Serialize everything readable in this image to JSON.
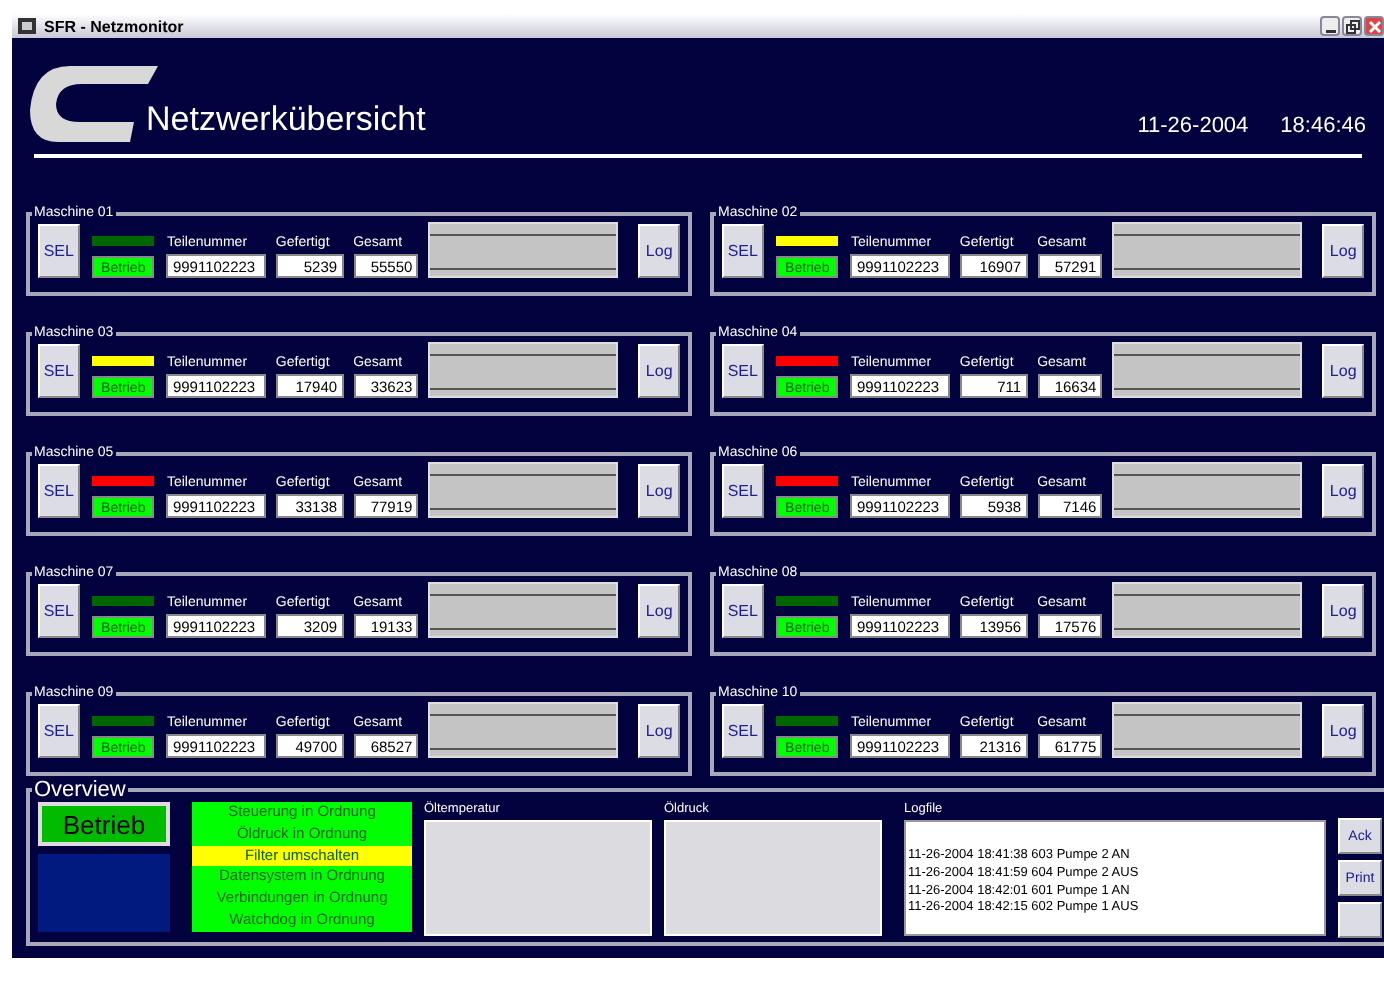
{
  "window": {
    "title": "SFR - Netzmonitor"
  },
  "header": {
    "title": "Netzwerkübersicht",
    "date": "11-26-2004",
    "time": "18:46:46"
  },
  "machines": [
    {
      "name": "Maschine 01",
      "sel": "SEL",
      "log": "Log",
      "color": "#006600",
      "status": "Betrieb",
      "part_label": "Teilenummer",
      "made_label": "Gefertigt",
      "total_label": "Gesamt",
      "part": "9991102223",
      "made": "5239",
      "total": "55550"
    },
    {
      "name": "Maschine 02",
      "sel": "SEL",
      "log": "Log",
      "color": "#ffff00",
      "status": "Betrieb",
      "part_label": "Teilenummer",
      "made_label": "Gefertigt",
      "total_label": "Gesamt",
      "part": "9991102223",
      "made": "16907",
      "total": "57291"
    },
    {
      "name": "Maschine 03",
      "sel": "SEL",
      "log": "Log",
      "color": "#ffff00",
      "status": "Betrieb",
      "part_label": "Teilenummer",
      "made_label": "Gefertigt",
      "total_label": "Gesamt",
      "part": "9991102223",
      "made": "17940",
      "total": "33623"
    },
    {
      "name": "Maschine 04",
      "sel": "SEL",
      "log": "Log",
      "color": "#ff0000",
      "status": "Betrieb",
      "part_label": "Teilenummer",
      "made_label": "Gefertigt",
      "total_label": "Gesamt",
      "part": "9991102223",
      "made": "711",
      "total": "16634"
    },
    {
      "name": "Maschine 05",
      "sel": "SEL",
      "log": "Log",
      "color": "#ff0000",
      "status": "Betrieb",
      "part_label": "Teilenummer",
      "made_label": "Gefertigt",
      "total_label": "Gesamt",
      "part": "9991102223",
      "made": "33138",
      "total": "77919"
    },
    {
      "name": "Maschine 06",
      "sel": "SEL",
      "log": "Log",
      "color": "#ff0000",
      "status": "Betrieb",
      "part_label": "Teilenummer",
      "made_label": "Gefertigt",
      "total_label": "Gesamt",
      "part": "9991102223",
      "made": "5938",
      "total": "7146"
    },
    {
      "name": "Maschine 07",
      "sel": "SEL",
      "log": "Log",
      "color": "#006600",
      "status": "Betrieb",
      "part_label": "Teilenummer",
      "made_label": "Gefertigt",
      "total_label": "Gesamt",
      "part": "9991102223",
      "made": "3209",
      "total": "19133"
    },
    {
      "name": "Maschine 08",
      "sel": "SEL",
      "log": "Log",
      "color": "#006600",
      "status": "Betrieb",
      "part_label": "Teilenummer",
      "made_label": "Gefertigt",
      "total_label": "Gesamt",
      "part": "9991102223",
      "made": "13956",
      "total": "17576"
    },
    {
      "name": "Maschine 09",
      "sel": "SEL",
      "log": "Log",
      "color": "#006600",
      "status": "Betrieb",
      "part_label": "Teilenummer",
      "made_label": "Gefertigt",
      "total_label": "Gesamt",
      "part": "9991102223",
      "made": "49700",
      "total": "68527"
    },
    {
      "name": "Maschine 10",
      "sel": "SEL",
      "log": "Log",
      "color": "#006600",
      "status": "Betrieb",
      "part_label": "Teilenummer",
      "made_label": "Gefertigt",
      "total_label": "Gesamt",
      "part": "9991102223",
      "made": "21316",
      "total": "61775"
    }
  ],
  "overview": {
    "title": "Overview",
    "state": "Betrieb",
    "messages": [
      {
        "text": "Steuerung in Ordnung",
        "color": "#00ff00"
      },
      {
        "text": "Öldruck in Ordnung",
        "color": "#00ff00"
      },
      {
        "text": "Filter umschalten",
        "color": "#ffff00"
      },
      {
        "text": "Datensystem in Ordnung",
        "color": "#00ff00"
      },
      {
        "text": "Verbindungen in Ordnung",
        "color": "#00ff00"
      },
      {
        "text": "Watchdog in Ordnung",
        "color": "#00ff00"
      }
    ],
    "oil_temp_label": "Öltemperatur",
    "oil_pressure_label": "Öldruck",
    "logfile_label": "Logfile",
    "log": [
      "11-26-2004 18:41:38 603 Pumpe 2 AN",
      "11-26-2004 18:41:59 604 Pumpe 2 AUS",
      "11-26-2004 18:42:01 601 Pumpe 1 AN",
      "11-26-2004 18:42:15 602 Pumpe 1 AUS"
    ],
    "buttons": [
      {
        "kind": "text",
        "label": "Ack"
      },
      {
        "kind": "text",
        "label": "Print"
      },
      {
        "kind": "blank"
      }
    ]
  }
}
